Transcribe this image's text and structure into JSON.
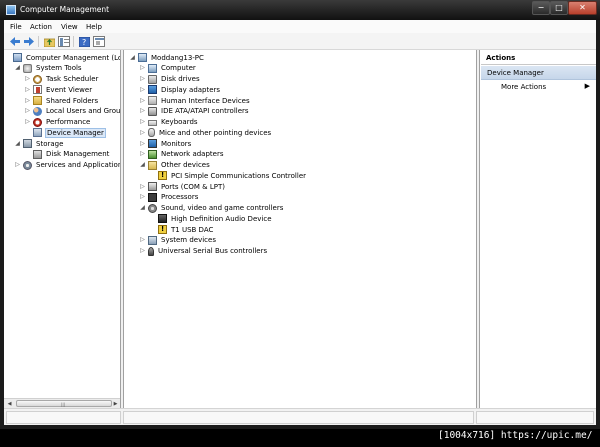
{
  "window": {
    "title": "Computer Management",
    "min_glyph": "−",
    "max_glyph": "□",
    "close_glyph": "✕"
  },
  "menu": [
    "File",
    "Action",
    "View",
    "Help"
  ],
  "toolbar": {
    "icons": [
      "back-arrow-icon",
      "forward-arrow-icon",
      "up-folder-icon",
      "show-hide-tree-icon",
      "help-icon",
      "properties-icon"
    ]
  },
  "left_tree": [
    {
      "label": "Computer Management (Local",
      "icon": "computer-management-icon",
      "level": 0,
      "twisty": ""
    },
    {
      "label": "System Tools",
      "icon": "system-tools-icon",
      "level": 1,
      "twisty": "◢"
    },
    {
      "label": "Task Scheduler",
      "icon": "task-scheduler-icon",
      "level": 2,
      "twisty": "▷"
    },
    {
      "label": "Event Viewer",
      "icon": "event-viewer-icon",
      "level": 2,
      "twisty": "▷"
    },
    {
      "label": "Shared Folders",
      "icon": "shared-folders-icon",
      "level": 2,
      "twisty": "▷"
    },
    {
      "label": "Local Users and Groups",
      "icon": "local-users-icon",
      "level": 2,
      "twisty": "▷"
    },
    {
      "label": "Performance",
      "icon": "performance-icon",
      "level": 2,
      "twisty": "▷"
    },
    {
      "label": "Device Manager",
      "icon": "device-manager-icon",
      "level": 2,
      "twisty": "",
      "selected": true
    },
    {
      "label": "Storage",
      "icon": "storage-icon",
      "level": 1,
      "twisty": "◢"
    },
    {
      "label": "Disk Management",
      "icon": "disk-management-icon",
      "level": 2,
      "twisty": ""
    },
    {
      "label": "Services and Applications",
      "icon": "services-applications-icon",
      "level": 1,
      "twisty": "▷"
    }
  ],
  "device_tree": [
    {
      "label": "Moddang13-PC",
      "icon": "computer-icon",
      "level": 0,
      "twisty": "◢"
    },
    {
      "label": "Computer",
      "icon": "computer-icon",
      "level": 1,
      "twisty": "▷"
    },
    {
      "label": "Disk drives",
      "icon": "disk-drive-icon",
      "level": 1,
      "twisty": "▷"
    },
    {
      "label": "Display adapters",
      "icon": "display-adapter-icon",
      "level": 1,
      "twisty": "▷"
    },
    {
      "label": "Human Interface Devices",
      "icon": "hid-icon",
      "level": 1,
      "twisty": "▷"
    },
    {
      "label": "IDE ATA/ATAPI controllers",
      "icon": "ide-controller-icon",
      "level": 1,
      "twisty": "▷"
    },
    {
      "label": "Keyboards",
      "icon": "keyboard-icon",
      "level": 1,
      "twisty": "▷"
    },
    {
      "label": "Mice and other pointing devices",
      "icon": "mouse-icon",
      "level": 1,
      "twisty": "▷"
    },
    {
      "label": "Monitors",
      "icon": "monitor-icon",
      "level": 1,
      "twisty": "▷"
    },
    {
      "label": "Network adapters",
      "icon": "network-adapter-icon",
      "level": 1,
      "twisty": "▷"
    },
    {
      "label": "Other devices",
      "icon": "other-devices-icon",
      "level": 1,
      "twisty": "◢"
    },
    {
      "label": "PCI Simple Communications Controller",
      "icon": "warning-device-icon",
      "level": 2,
      "twisty": ""
    },
    {
      "label": "Ports (COM & LPT)",
      "icon": "port-icon",
      "level": 1,
      "twisty": "▷"
    },
    {
      "label": "Processors",
      "icon": "processor-icon",
      "level": 1,
      "twisty": "▷"
    },
    {
      "label": "Sound, video and game controllers",
      "icon": "sound-icon",
      "level": 1,
      "twisty": "◢"
    },
    {
      "label": "High Definition Audio Device",
      "icon": "speaker-icon",
      "level": 2,
      "twisty": ""
    },
    {
      "label": "T1 USB DAC",
      "icon": "warning-device-icon",
      "level": 2,
      "twisty": ""
    },
    {
      "label": "System devices",
      "icon": "system-devices-icon",
      "level": 1,
      "twisty": "▷"
    },
    {
      "label": "Universal Serial Bus controllers",
      "icon": "usb-icon",
      "level": 1,
      "twisty": "▷"
    }
  ],
  "actions": {
    "header": "Actions",
    "section": "Device Manager",
    "items": [
      {
        "label": "More Actions",
        "arrow": "▶"
      }
    ]
  },
  "scrollbar": {
    "left_arrow": "◀",
    "right_arrow": "▶",
    "grip": "|||"
  },
  "watermark": "[1004x716] https://upic.me/"
}
